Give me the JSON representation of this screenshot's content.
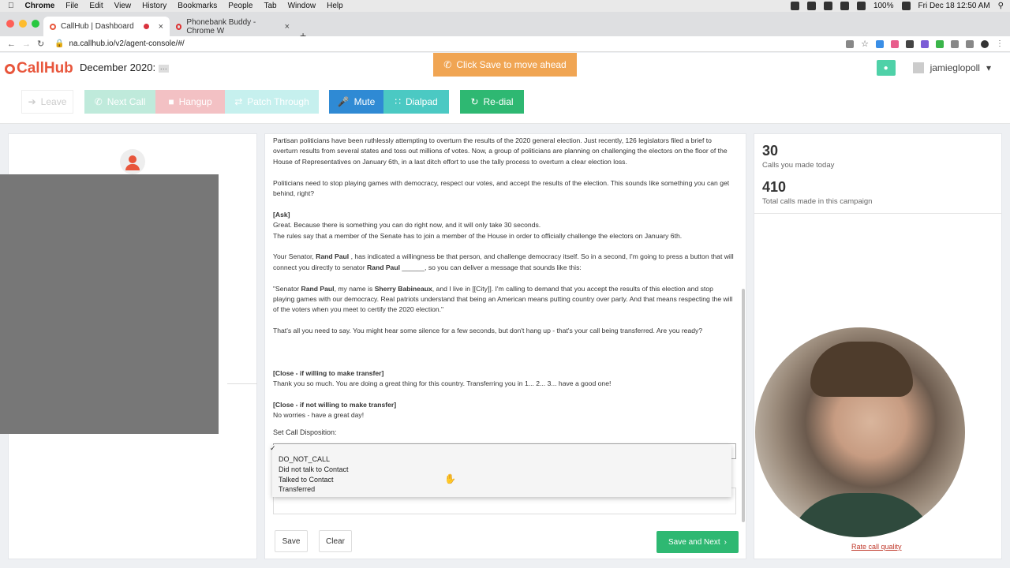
{
  "menubar": {
    "apple": "",
    "app": "Chrome",
    "items": [
      "File",
      "Edit",
      "View",
      "History",
      "Bookmarks",
      "People",
      "Tab",
      "Window",
      "Help"
    ],
    "battery": "100%",
    "datetime": "Fri Dec 18  12:50 AM"
  },
  "tabs": [
    {
      "title": "CallHub | Dashboard",
      "active": true
    },
    {
      "title": "Phonebank Buddy - Chrome W",
      "active": false
    }
  ],
  "address": {
    "url": "na.callhub.io/v2/agent-console/#/"
  },
  "header": {
    "logo": "CallHub",
    "campaign": "December 2020:",
    "campaign_more": "···",
    "banner": "Click Save to move ahead",
    "username": "jamieglopoll"
  },
  "toolbar": {
    "leave": "Leave",
    "next_call": "Next Call",
    "hangup": "Hangup",
    "patch_through": "Patch Through",
    "mute": "Mute",
    "dialpad": "Dialpad",
    "redial": "Re-dial"
  },
  "script": {
    "p1": "Partisan politicians have been ruthlessly attempting to overturn the results of the 2020 general election. Just recently, 126 legislators filed a brief to overturn results from several states and toss out millions of votes. Now, a group of politicians are planning on challenging the electors on the floor of the House of Representatives on January 6th, in a last ditch effort to use the tally process to overturn a clear election loss.",
    "p2": "Politicians need to stop playing games with democracy, respect our votes, and accept the results of the election. This sounds like something you can get behind, right?",
    "ask_title": "[Ask]",
    "ask_l1": "Great. Because there is something you can do right now, and it will only take 30 seconds.",
    "ask_l2": "The rules say that a member of the Senate has to join a member of the House in order to officially challenge the electors on January 6th.",
    "p3_a": "Your Senator, ",
    "senator": "Rand Paul",
    "p3_b": " , has indicated a willingness be that person, and challenge democracy itself. So in a second, I'm going to press a button that will connect you directly to senator ",
    "p3_c": " ______, so you can deliver a message that sounds like this:",
    "p4_a": "\"Senator ",
    "p4_b": ", my name is ",
    "caller": "Sherry Babineaux",
    "p4_c": ", and I live in [[City]]. I'm calling to demand that you accept the results of this election and stop playing games with our democracy. Real patriots understand that being an American means putting country over party. And that means respecting the will of the voters when you meet to certify the 2020 election.\"",
    "p5": "That's all you need to say. You might hear some silence for a few seconds, but don't hang up - that's your call being transferred. Are you ready?",
    "close1_title": "[Close - if willing to make transfer]",
    "close1": "Thank you so much. You are doing a great thing for this country. Transferring you in 1... 2... 3... have a good one!",
    "close2_title": "[Close - if not willing to make transfer]",
    "close2": "No worries - have a great day!"
  },
  "disposition": {
    "label": "Set Call Disposition:",
    "check": "✓",
    "options": [
      "DO_NOT_CALL",
      "Did not talk to Contact",
      "Talked to Contact",
      "Transferred"
    ]
  },
  "actions": {
    "save": "Save",
    "clear": "Clear",
    "save_next": "Save and Next"
  },
  "stats": {
    "today_count": "30",
    "today_label": "Calls you made today",
    "total_count": "410",
    "total_label": "Total calls made in this campaign"
  },
  "rate_link": "Rate call quality"
}
